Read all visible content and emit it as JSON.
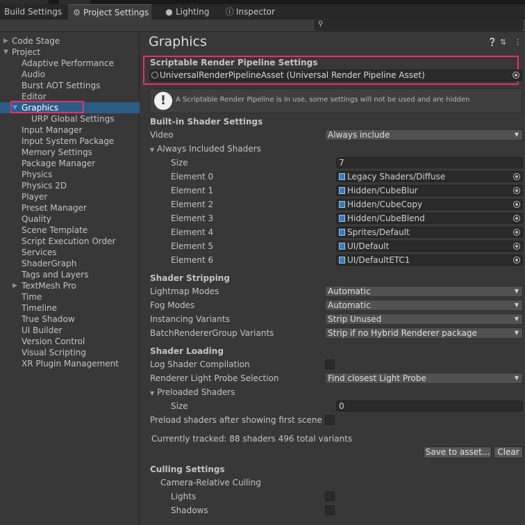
{
  "tabs": [
    {
      "label": "Build Settings",
      "icon": "none"
    },
    {
      "label": "Project Settings",
      "icon": "gear-icon"
    },
    {
      "label": "Lighting",
      "icon": "bulb-icon"
    },
    {
      "label": "Inspector",
      "icon": "info-icon"
    }
  ],
  "search": {
    "placeholder": ""
  },
  "sidebar": {
    "items": [
      {
        "label": "Code Stage"
      },
      {
        "label": "Project"
      },
      {
        "label": "Adaptive Performance"
      },
      {
        "label": "Audio"
      },
      {
        "label": "Burst AOT Settings"
      },
      {
        "label": "Editor"
      },
      {
        "label": "Graphics"
      },
      {
        "label": "URP Global Settings"
      },
      {
        "label": "Input Manager"
      },
      {
        "label": "Input System Package"
      },
      {
        "label": "Memory Settings"
      },
      {
        "label": "Package Manager"
      },
      {
        "label": "Physics"
      },
      {
        "label": "Physics 2D"
      },
      {
        "label": "Player"
      },
      {
        "label": "Preset Manager"
      },
      {
        "label": "Quality"
      },
      {
        "label": "Scene Template"
      },
      {
        "label": "Script Execution Order"
      },
      {
        "label": "Services"
      },
      {
        "label": "ShaderGraph"
      },
      {
        "label": "Tags and Layers"
      },
      {
        "label": "TextMesh Pro"
      },
      {
        "label": "Time"
      },
      {
        "label": "Timeline"
      },
      {
        "label": "True Shadow"
      },
      {
        "label": "UI Builder"
      },
      {
        "label": "Version Control"
      },
      {
        "label": "Visual Scripting"
      },
      {
        "label": "XR Plugin Management"
      }
    ]
  },
  "main": {
    "title": "Graphics",
    "srp": {
      "heading": "Scriptable Render Pipeline Settings",
      "asset": "UniversalRenderPipelineAsset (Universal Render Pipeline Asset)"
    },
    "help_message": "A Scriptable Render Pipeline is in use, some settings will not be used and are hidden",
    "builtin": {
      "heading": "Built-in Shader Settings",
      "video_label": "Video",
      "video_value": "Always include",
      "always_included_label": "Always Included Shaders",
      "size_label": "Size",
      "size_value": "7",
      "elements": [
        {
          "label": "Element 0",
          "value": "Legacy Shaders/Diffuse"
        },
        {
          "label": "Element 1",
          "value": "Hidden/CubeBlur"
        },
        {
          "label": "Element 2",
          "value": "Hidden/CubeCopy"
        },
        {
          "label": "Element 3",
          "value": "Hidden/CubeBlend"
        },
        {
          "label": "Element 4",
          "value": "Sprites/Default"
        },
        {
          "label": "Element 5",
          "value": "UI/Default"
        },
        {
          "label": "Element 6",
          "value": "UI/DefaultETC1"
        }
      ]
    },
    "stripping": {
      "heading": "Shader Stripping",
      "rows": [
        {
          "label": "Lightmap Modes",
          "value": "Automatic"
        },
        {
          "label": "Fog Modes",
          "value": "Automatic"
        },
        {
          "label": "Instancing Variants",
          "value": "Strip Unused"
        },
        {
          "label": "BatchRendererGroup Variants",
          "value": "Strip if no Hybrid Renderer package"
        }
      ]
    },
    "loading": {
      "heading": "Shader Loading",
      "log_label": "Log Shader Compilation",
      "probe_label": "Renderer Light Probe Selection",
      "probe_value": "Find closest Light Probe",
      "preloaded_label": "Preloaded Shaders",
      "size_label": "Size",
      "size_value": "0",
      "preload_after_label": "Preload shaders after showing first scene",
      "tracked_text": "Currently tracked: 88 shaders 496 total variants",
      "save_button": "Save to asset...",
      "clear_button": "Clear"
    },
    "culling": {
      "heading": "Culling Settings",
      "camera_relative": "Camera-Relative Culling",
      "lights": "Lights",
      "shadows": "Shadows"
    }
  },
  "colors": {
    "highlight": "#e8306a",
    "selection": "#2c5d87",
    "panel": "#383838"
  }
}
